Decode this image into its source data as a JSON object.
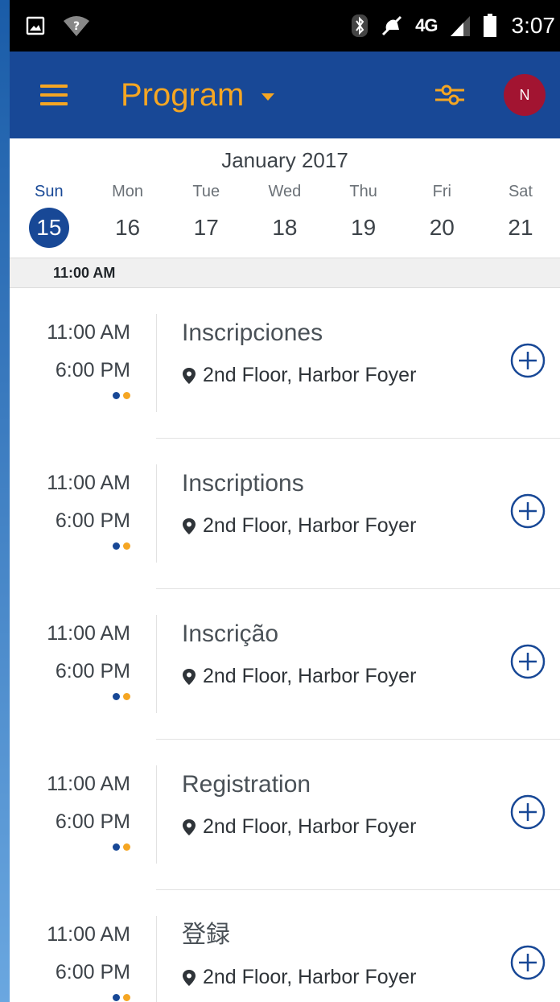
{
  "status_bar": {
    "time": "3:07",
    "network": "4G"
  },
  "app_bar": {
    "title": "Program",
    "avatar_initial": "N",
    "accent_color": "#f5a623",
    "bar_color": "#184896"
  },
  "calendar": {
    "month": "January 2017",
    "days": [
      {
        "name": "Sun",
        "num": "15",
        "active": true
      },
      {
        "name": "Mon",
        "num": "16",
        "active": false
      },
      {
        "name": "Tue",
        "num": "17",
        "active": false
      },
      {
        "name": "Wed",
        "num": "18",
        "active": false
      },
      {
        "name": "Thu",
        "num": "19",
        "active": false
      },
      {
        "name": "Fri",
        "num": "20",
        "active": false
      },
      {
        "name": "Sat",
        "num": "21",
        "active": false
      }
    ]
  },
  "time_group": "11:00 AM",
  "sessions": [
    {
      "start": "11:00 AM",
      "end": "6:00 PM",
      "title": "Inscripciones",
      "location": "2nd Floor, Harbor Foyer",
      "dot_colors": [
        "#184896",
        "#f5a623"
      ]
    },
    {
      "start": "11:00 AM",
      "end": "6:00 PM",
      "title": "Inscriptions",
      "location": "2nd Floor, Harbor Foyer",
      "dot_colors": [
        "#184896",
        "#f5a623"
      ]
    },
    {
      "start": "11:00 AM",
      "end": "6:00 PM",
      "title": "Inscrição",
      "location": "2nd Floor, Harbor Foyer",
      "dot_colors": [
        "#184896",
        "#f5a623"
      ]
    },
    {
      "start": "11:00 AM",
      "end": "6:00 PM",
      "title": "Registration",
      "location": "2nd Floor, Harbor Foyer",
      "dot_colors": [
        "#184896",
        "#f5a623"
      ]
    },
    {
      "start": "11:00 AM",
      "end": "6:00 PM",
      "title": "登録",
      "location": "2nd Floor, Harbor Foyer",
      "dot_colors": [
        "#184896",
        "#f5a623"
      ]
    }
  ]
}
